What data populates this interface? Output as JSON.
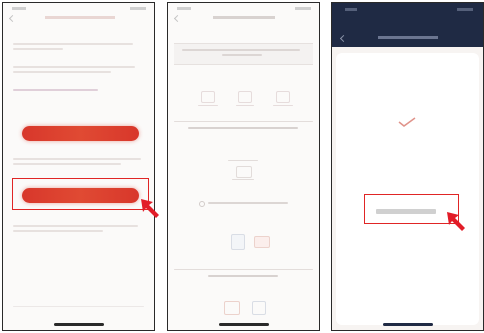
{
  "colors": {
    "accent": "#d8372b",
    "highlight_box": "#e02525",
    "arrow": "#e21c28",
    "phone_border": "#2a2a2a",
    "screen_bg": "#fbfaf9",
    "dark_header": "#1f2a44"
  },
  "screens": [
    {
      "title": "",
      "primary_button_label": "",
      "highlighted_button_label": ""
    },
    {
      "title": ""
    },
    {
      "title": "",
      "highlighted_field_label": ""
    }
  ]
}
